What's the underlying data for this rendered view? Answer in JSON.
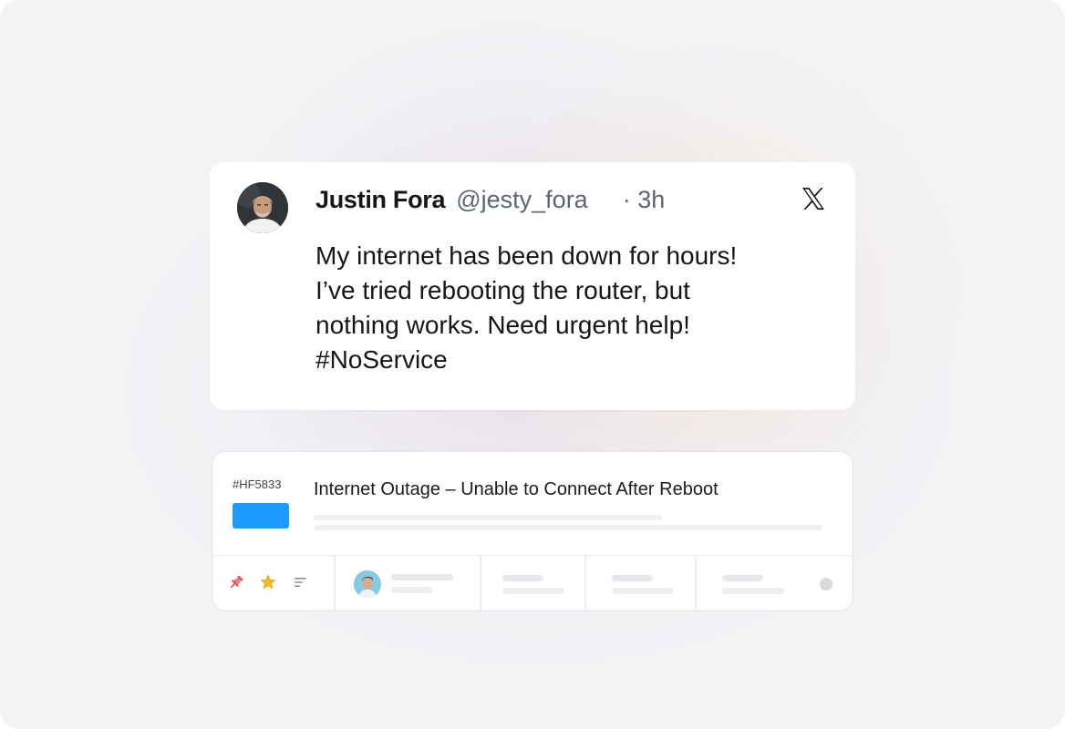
{
  "tweet": {
    "author_name": "Justin Fora",
    "author_handle": "@jesty_fora",
    "time": "· 3h",
    "platform_icon": "x-logo-icon",
    "text_lines": [
      "My internet has been down for hours!",
      "I’ve tried rebooting the router, but",
      "nothing works. Need urgent help!",
      "#NoService"
    ]
  },
  "ticket": {
    "id": "#HF5833",
    "subject": "Internet Outage – Unable to Connect After Reboot",
    "status_color": "#1a9bfc",
    "footer_icons": [
      "pin-icon",
      "star-icon",
      "list-icon"
    ]
  },
  "colors": {
    "pin": "#e8505b",
    "star": "#f5b82e",
    "list": "#8a8f98"
  }
}
